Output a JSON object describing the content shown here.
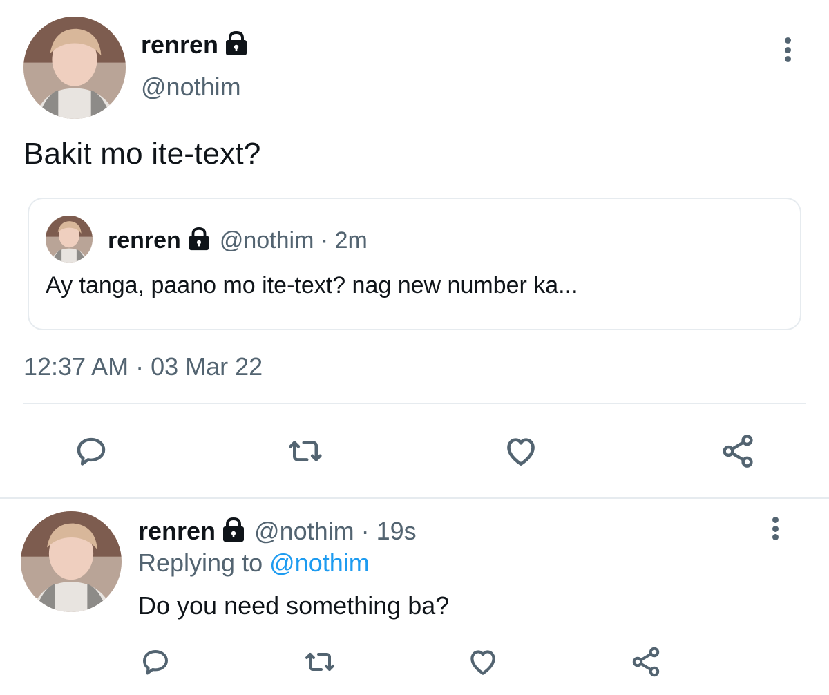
{
  "main_tweet": {
    "display_name": "renren",
    "handle": "@nothim",
    "text": "Bakit mo ite-text?",
    "timestamp": "12:37 AM · 03 Mar 22",
    "quoted": {
      "display_name": "renren",
      "handle_time": "@nothim · 2m",
      "text": "Ay tanga, paano mo ite-text? nag new number ka..."
    }
  },
  "reply_tweet": {
    "display_name": "renren",
    "handle_time": "@nothim · 19s",
    "replying_prefix": "Replying to",
    "replying_handle": "@nothim",
    "text": "Do you need something ba?"
  },
  "icons": [
    "lock-icon",
    "more-icon",
    "reply-icon",
    "retweet-icon",
    "like-icon",
    "share-icon"
  ],
  "colors": {
    "text": "#0f1419",
    "muted": "#536471",
    "link": "#1d9bf0",
    "border": "#e6ebef"
  }
}
